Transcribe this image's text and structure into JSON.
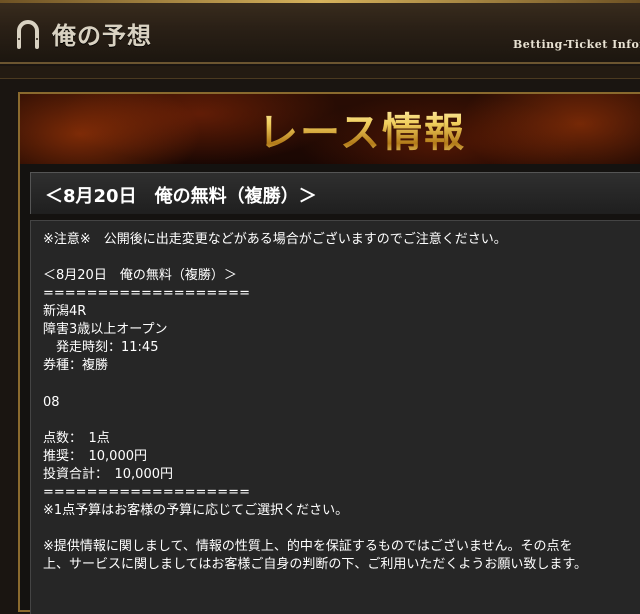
{
  "header": {
    "site_title": "俺の予想",
    "tagline": "Betting-Ticket Infor"
  },
  "banner": {
    "title": "レース情報"
  },
  "post": {
    "heading": "＜8月20日　俺の無料（複勝）＞",
    "lines": [
      "※注意※　公開後に出走変更などがある場合がございますのでご注意ください。",
      "＜8月20日　俺の無料（複勝）＞",
      "===================",
      "新潟4R",
      "障害3歳以上オープン",
      "　発走時刻：11:45",
      "券種：複勝",
      "08",
      "点数：　1点",
      "推奨：　10,000円",
      "投資合計：　10,000円",
      "===================",
      "※1点予算はお客様の予算に応じてご選択ください。",
      "※提供情報に関しまして、情報の性質上、的中を保証するものではございません。その点を",
      "上、サービスに関しましてはお客様ご自身の判断の下、ご利用いただくようお願い致します。"
    ]
  },
  "colors": {
    "accent_gold": "#d6b25c",
    "background": "#1a1511",
    "content_bg": "#262626"
  }
}
